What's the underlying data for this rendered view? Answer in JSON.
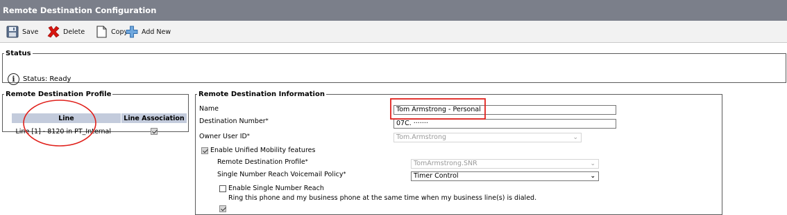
{
  "page_title": "Remote Destination Configuration",
  "toolbar": {
    "save_label": "Save",
    "delete_label": "Delete",
    "copy_label": "Copy",
    "add_new_label": "Add New"
  },
  "status": {
    "legend": "Status",
    "text": "Status: Ready"
  },
  "profile": {
    "legend": "Remote Destination Profile",
    "columns": [
      "Line",
      "Line Association"
    ],
    "rows": [
      {
        "line": "Line [1] - 8120 in PT_Internal",
        "associated": true
      }
    ]
  },
  "info": {
    "legend": "Remote Destination Information",
    "name_label": "Name",
    "name_value": "Tom Armstrong - Personal",
    "dest_label": "Destination Number",
    "dest_value": "07C. ·······",
    "owner_label": "Owner User ID",
    "owner_value": "Tom.Armstrong",
    "unified_label": "Enable Unified Mobility features",
    "rdp_label": "Remote Destination Profile",
    "rdp_value": "TomArmstrong.SNR",
    "vm_label": "Single Number Reach Voicemail Policy",
    "vm_value": "Timer Control",
    "snr_label": "Enable Single Number Reach",
    "snr_desc": "Ring this phone and my business phone at the same time when my business line(s) is dialed.",
    "required_marker": "*"
  },
  "colors": {
    "title_bar": "#7b7f8a",
    "table_header": "#c3cbdc",
    "annotation_red": "#e0201b"
  }
}
